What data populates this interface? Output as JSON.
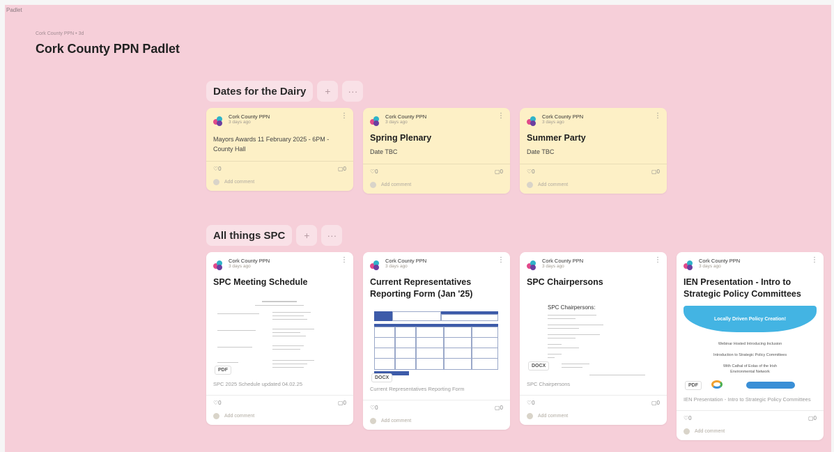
{
  "app": {
    "name": "Padlet"
  },
  "header": {
    "breadcrumb": "Cork County PPN • 3d",
    "title": "Cork County PPN Padlet"
  },
  "sections": [
    {
      "title": "Dates for the Dairy",
      "add_icon": "+",
      "more_icon": "···",
      "cards": [
        {
          "author": "Cork County PPN",
          "time": "3 days ago",
          "title": "",
          "body": "Mayors Awards 11 February 2025 - 6PM - County Hall",
          "likes": "0",
          "comments": "0",
          "add_comment": "Add comment"
        },
        {
          "author": "Cork County PPN",
          "time": "3 days ago",
          "title": "Spring Plenary",
          "body": "Date TBC",
          "likes": "0",
          "comments": "0",
          "add_comment": "Add comment"
        },
        {
          "author": "Cork County PPN",
          "time": "3 days ago",
          "title": "Summer Party",
          "body": "Date TBC",
          "likes": "0",
          "comments": "0",
          "add_comment": "Add comment"
        }
      ]
    },
    {
      "title": "All things SPC",
      "add_icon": "+",
      "more_icon": "···",
      "cards": [
        {
          "author": "Cork County PPN",
          "time": "3 days ago",
          "title": "SPC Meeting Schedule",
          "file_type": "PDF",
          "caption": "SPC 2025 Schedule updated 04.02.25",
          "likes": "0",
          "comments": "0",
          "add_comment": "Add comment"
        },
        {
          "author": "Cork County PPN",
          "time": "3 days ago",
          "title": "Current Representatives Reporting Form (Jan '25)",
          "file_type": "DOCX",
          "caption": "Current Representatives Reporting Form",
          "likes": "0",
          "comments": "0",
          "add_comment": "Add comment"
        },
        {
          "author": "Cork County PPN",
          "time": "3 days ago",
          "title": "SPC Chairpersons",
          "file_type": "DOCX",
          "preview_heading": "SPC Chairpersons:",
          "caption": "SPC Chairpersons",
          "likes": "0",
          "comments": "0",
          "add_comment": "Add comment"
        },
        {
          "author": "Cork County PPN",
          "time": "3 days ago",
          "title": "IEN Presentation - Intro to Strategic Policy Committees",
          "file_type": "PDF",
          "preview_banner": "Locally Driven Policy Creation!",
          "preview_lines": [
            "Webinar Hosted Introducing Inclusion",
            "Introduction to Strategic Policy Committees",
            "With Cathal of Eolas of the Irish",
            "Environmental Network"
          ],
          "caption": "IEN Presentation - Intro to Strategic Policy Committees",
          "likes": "0",
          "comments": "0",
          "add_comment": "Add comment"
        }
      ]
    }
  ],
  "colors": {
    "background": "#f6cfd9",
    "date_card": "#fdf0c6",
    "spc_card": "#ffffff",
    "ien_banner": "#43b4e3"
  },
  "icons": {
    "like": "heart-icon",
    "comment": "comment-icon",
    "menu": "kebab-menu-icon",
    "author": "ppn-logo-icon"
  }
}
